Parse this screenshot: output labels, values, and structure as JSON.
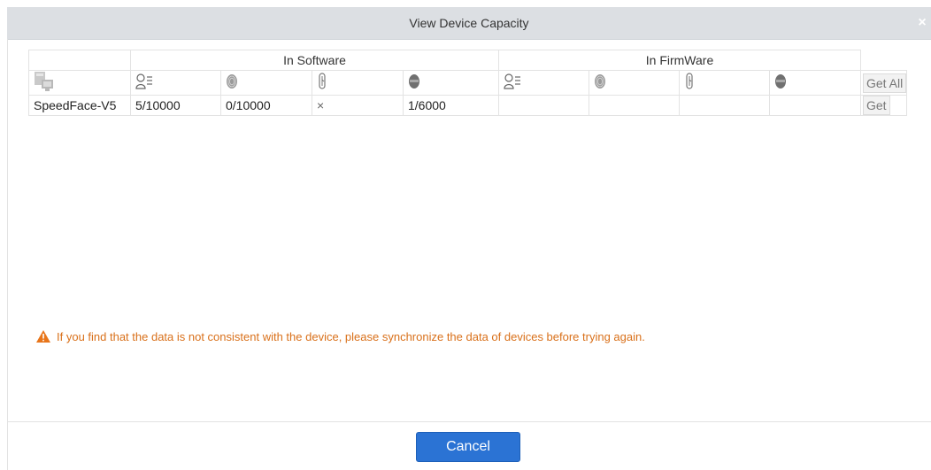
{
  "dialog": {
    "title": "View Device Capacity",
    "close_glyph": "×"
  },
  "table": {
    "group_headers": {
      "software": "In Software",
      "firmware": "In FirmWare"
    },
    "column_icons": [
      "device-icon",
      "user-face-list-icon",
      "fingerprint-icon",
      "finger-vein-icon",
      "face-icon"
    ],
    "get_all_label": "Get All",
    "rows": [
      {
        "device": "SpeedFace-V5",
        "software": {
          "users": "5/10000",
          "fingerprint": "0/10000",
          "finger_vein": "×",
          "face": "1/6000"
        },
        "firmware": {
          "users": "",
          "fingerprint": "",
          "finger_vein": "",
          "face": ""
        },
        "get_label": "Get"
      }
    ]
  },
  "warning": {
    "icon": "warning-triangle-icon",
    "text": "If you find that the data is not consistent with the device, please synchronize the data of devices before trying again.",
    "color": "#d9701a"
  },
  "footer": {
    "cancel_label": "Cancel"
  },
  "colors": {
    "accent": "#2b73d4",
    "titlebar": "#dcdfe3"
  }
}
